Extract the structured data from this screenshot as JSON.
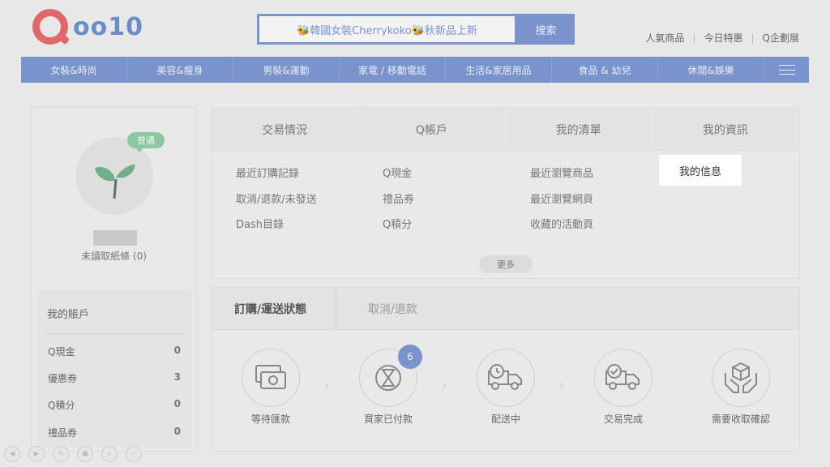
{
  "header": {
    "logo_text": "oo10",
    "search_value": "🐝韓國女裝Cherrykoko🐝秋新品上新",
    "search_button": "搜索",
    "top_links": [
      "人氣商品",
      "今日特惠",
      "Q企劃展"
    ]
  },
  "nav": {
    "items": [
      "女裝&時尚",
      "美容&瘦身",
      "男裝&運動",
      "家電 / 移動電話",
      "生活&家居用品",
      "食品 & 幼兒",
      "休閒&娛樂"
    ]
  },
  "profile": {
    "badge": "普通",
    "unread": "未讀取紙條 (0)"
  },
  "account": {
    "title": "我的賬戶",
    "rows": [
      {
        "label": "Q現金",
        "value": "0"
      },
      {
        "label": "優惠券",
        "value": "3"
      },
      {
        "label": "Q積分",
        "value": "0"
      },
      {
        "label": "禮品券",
        "value": "0"
      }
    ]
  },
  "tabs": [
    "交易情況",
    "Q帳戶",
    "我的清單",
    "我的資訊"
  ],
  "links": {
    "col1": [
      "最近訂購記錄",
      "取消/退款/未發送",
      "Dash目錄"
    ],
    "col2": [
      "Q現金",
      "禮品券",
      "Q積分"
    ],
    "col3": [
      "最近瀏覽商品",
      "最近瀏覽網頁",
      "收藏的活動頁"
    ],
    "col4": [
      "我的信息"
    ]
  },
  "more_button": "更多",
  "orders": {
    "tab_active": "訂購/運送狀態",
    "tab_inactive": "取消/退款",
    "steps": [
      "等待匯款",
      "買家已付款",
      "配送中",
      "交易完成",
      "需要收取確認"
    ],
    "paid_count": "6"
  },
  "colors": {
    "accent": "#7a93cd",
    "logo_red": "#e0686b",
    "badge_green": "#8cc9a2"
  }
}
